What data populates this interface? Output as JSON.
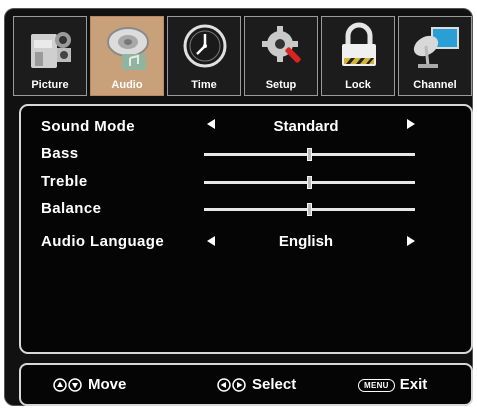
{
  "tabs": [
    {
      "label": "Picture",
      "icon": "camera-icon",
      "active": false
    },
    {
      "label": "Audio",
      "icon": "speaker-icon",
      "active": true
    },
    {
      "label": "Time",
      "icon": "clock-icon",
      "active": false
    },
    {
      "label": "Setup",
      "icon": "gear-wrench-icon",
      "active": false
    },
    {
      "label": "Lock",
      "icon": "padlock-icon",
      "active": false
    },
    {
      "label": "Channel",
      "icon": "satellite-dish-icon",
      "active": false
    }
  ],
  "settings": {
    "sound_mode": {
      "label": "Sound Mode",
      "value": "Standard"
    },
    "bass": {
      "label": "Bass",
      "level": 0.5
    },
    "treble": {
      "label": "Treble",
      "level": 0.5
    },
    "balance": {
      "label": "Balance",
      "level": 0.5
    },
    "audio_language": {
      "label": "Audio Language",
      "value": "English"
    }
  },
  "footer": {
    "move_label": "Move",
    "select_label": "Select",
    "menu_key_label": "MENU",
    "exit_label": "Exit"
  },
  "colors": {
    "active_tab": "#c8a07a",
    "panel_bg": "#050505",
    "border": "#d8d8d8"
  }
}
